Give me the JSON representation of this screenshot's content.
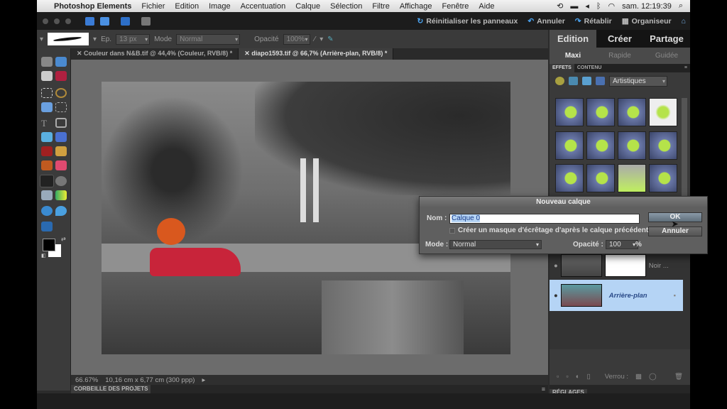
{
  "menubar": {
    "app_name": "Photoshop Elements",
    "items": [
      "Fichier",
      "Edition",
      "Image",
      "Accentuation",
      "Calque",
      "Sélection",
      "Filtre",
      "Affichage",
      "Fenêtre",
      "Aide"
    ],
    "clock": "sam. 12:19:39"
  },
  "appbar": {
    "reset_panels": "Réinitialiser les panneaux",
    "undo": "Annuler",
    "redo": "Rétablir",
    "organizer": "Organiseur"
  },
  "options": {
    "size_label": "Ep.",
    "size_value": "13 px",
    "mode_label": "Mode",
    "mode_value": "Normal",
    "opacity_label": "Opacité",
    "opacity_value": "100%"
  },
  "doc_tabs": [
    {
      "label": "Couleur dans N&B.tif @ 44,4% (Couleur, RVB/8) *",
      "active": false
    },
    {
      "label": "diapo1593.tif @ 66,7% (Arrière-plan, RVB/8) *",
      "active": true
    }
  ],
  "status": {
    "zoom": "66.67%",
    "dimensions": "10,16 cm x 6,77 cm (300 ppp)"
  },
  "project_bin": "CORBEILLE DES PROJETS",
  "right_panel": {
    "mode_tabs": [
      "Edition",
      "Créer",
      "Partage"
    ],
    "sub_tabs": [
      "Maxi",
      "Rapide",
      "Guidée"
    ],
    "panel_tabs": [
      "EFFETS",
      "CONTENU"
    ],
    "effects_category": "Artistiques",
    "layers": [
      {
        "name": "Noir ...",
        "selected": false
      },
      {
        "name": "Arrière-plan",
        "selected": true
      }
    ],
    "lock_label": "Verrou :",
    "adjustments_tab": "RÉGLAGES"
  },
  "dialog": {
    "title": "Nouveau calque",
    "name_label": "Nom :",
    "name_value": "Calque 0",
    "clip_checkbox": "Créer un masque d'écrêtage d'après le calque précédent",
    "clip_checked": false,
    "mode_label": "Mode :",
    "mode_value": "Normal",
    "opacity_label": "Opacité :",
    "opacity_value": "100",
    "opacity_unit": "%",
    "ok": "OK",
    "cancel": "Annuler"
  }
}
